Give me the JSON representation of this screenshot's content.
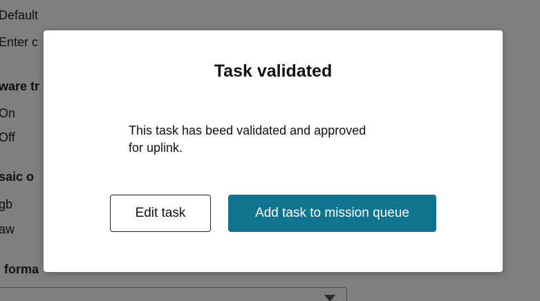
{
  "background": {
    "lines": [
      {
        "id": "default",
        "text": "Default"
      },
      {
        "id": "enter",
        "text": "Enter c"
      },
      {
        "id": "hw-heading",
        "text": "ware tr"
      },
      {
        "id": "on",
        "text": "On"
      },
      {
        "id": "off",
        "text": "Off"
      },
      {
        "id": "mosaic-heading",
        "text": "saic o"
      },
      {
        "id": "rgb",
        "text": "gb"
      },
      {
        "id": "raw",
        "text": "aw"
      },
      {
        "id": "format-heading",
        "text": "forma"
      }
    ]
  },
  "modal": {
    "title": "Task validated",
    "body": "This task has beed validated and approved for uplink.",
    "edit_label": "Edit task",
    "add_label": "Add task to mission queue"
  },
  "colors": {
    "primary": "#0e7490",
    "overlay": "rgba(0,0,0,0.5)"
  }
}
